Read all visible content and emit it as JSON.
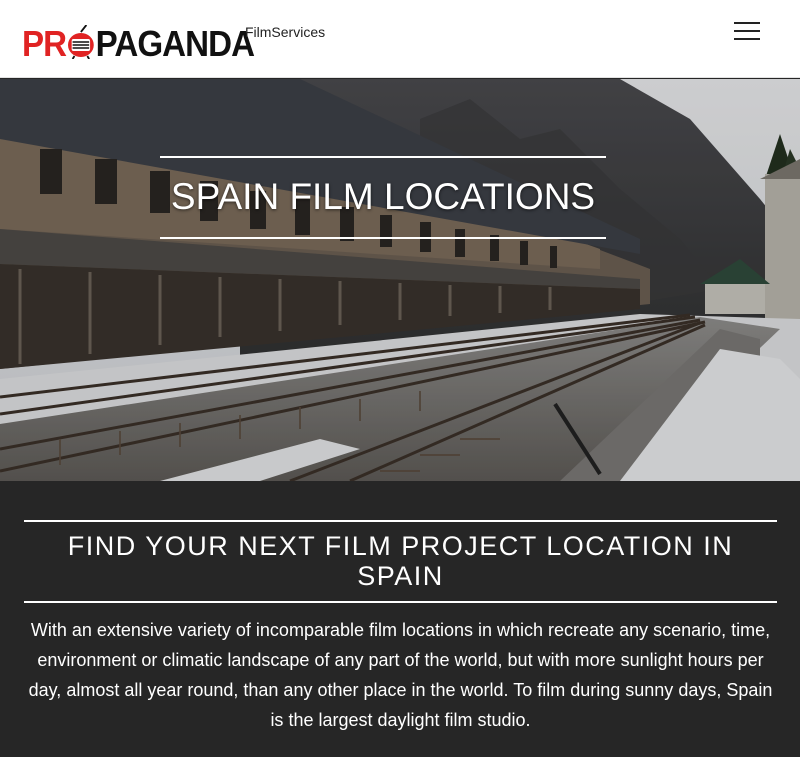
{
  "header": {
    "logo": {
      "part1": "PR",
      "part2": "PAGANDA",
      "sub": "FilmServices"
    },
    "menu_icon": "hamburger-menu-icon"
  },
  "hero": {
    "title": "SPAIN FILM LOCATIONS",
    "image": "snowy-railway-station-photo"
  },
  "info": {
    "heading": "FIND YOUR NEXT FILM PROJECT LOCATION IN SPAIN",
    "body": "With an extensive variety of incomparable film locations in which recreate any scenario, time, environment or climatic landscape of any part of the world, but with more sunlight hours per day, almost all year round, than any other place in the world. To film during sunny days, Spain is the largest daylight film studio."
  },
  "colors": {
    "brand_red": "#e02323",
    "dark_bg": "#262626"
  }
}
